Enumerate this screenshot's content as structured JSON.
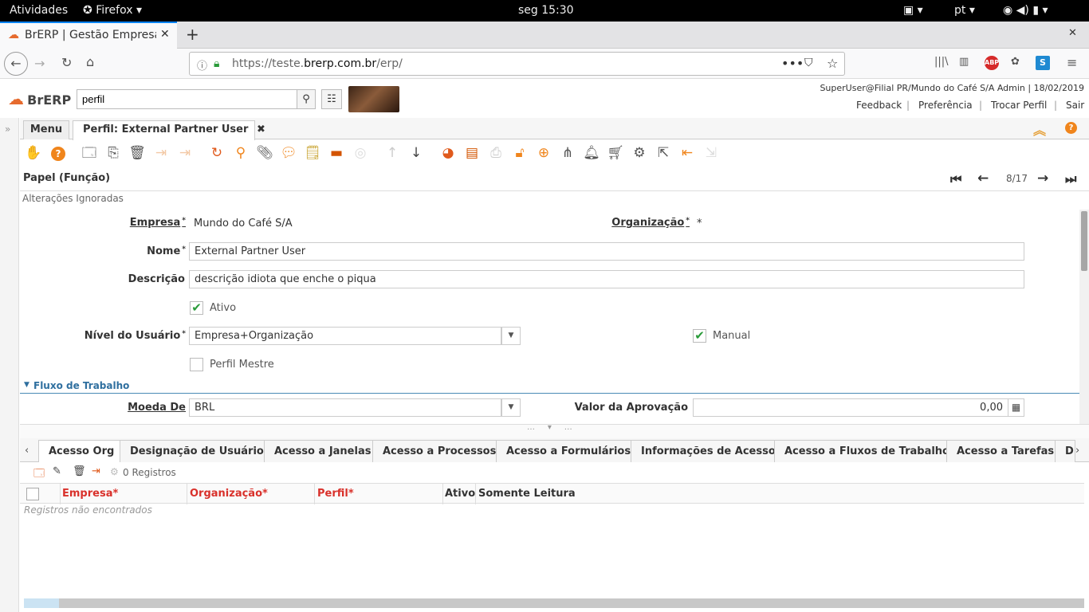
{
  "os_bar": {
    "activities": "Atividades",
    "app": "Firefox",
    "clock": "seg 15:30",
    "lang": "pt"
  },
  "browser": {
    "tab_title": "BrERP | Gestão Empresa",
    "url_prefix": "https://teste.",
    "url_domain": "brerp.com.br",
    "url_path": "/erp/"
  },
  "app": {
    "logo_text": "BrERP",
    "search_value": "perfil",
    "user_info": "SuperUser@Filial PR/Mundo do Café S/A Admin | 18/02/2019",
    "links": [
      "Feedback",
      "Preferência",
      "Trocar Perfil",
      "Sair"
    ]
  },
  "window": {
    "menu_tab": "Menu",
    "active_tab": "Perfil: External Partner User",
    "title": "Papel (Função)",
    "record_nav": "8/17",
    "status": "Alterações Ignoradas"
  },
  "form": {
    "empresa_label": "Empresa",
    "empresa_value": "Mundo do Café S/A",
    "organizacao_label": "Organização",
    "organizacao_value": "*",
    "nome_label": "Nome",
    "nome_value": "External Partner User",
    "descricao_label": "Descrição",
    "descricao_value": "descrição idiota que enche o piqua",
    "ativo_label": "Ativo",
    "ativo_checked": true,
    "nivel_label": "Nível do Usuário",
    "nivel_value": "Empresa+Organização",
    "manual_label": "Manual",
    "manual_checked": true,
    "perfil_mestre_label": "Perfil Mestre",
    "perfil_mestre_checked": false,
    "section_workflow": "Fluxo de Trabalho",
    "moeda_label": "Moeda De",
    "moeda_value": "BRL",
    "valor_label": "Valor da Aprovação",
    "valor_value": "0,00"
  },
  "subtabs": [
    "Acesso Org",
    "Designação de Usuário",
    "Acesso a Janelas",
    "Acesso a Processos",
    "Acesso a Formulários",
    "Informações de Acesso",
    "Acesso a Fluxos de Trabalho",
    "Acesso a Tarefas",
    "D"
  ],
  "grid": {
    "count": "0 Registros",
    "columns": [
      "Empresa*",
      "Organização*",
      "Perfil*",
      "Ativo",
      "Somente Leitura"
    ],
    "empty": "Registros não encontrados"
  }
}
